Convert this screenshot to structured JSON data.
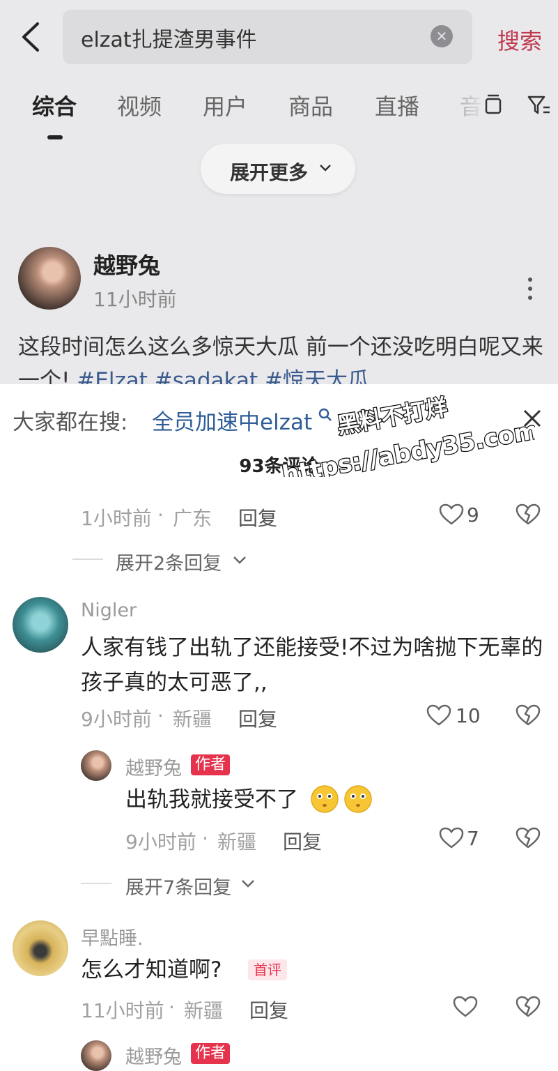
{
  "search": {
    "query": "elzat扎提渣男事件",
    "submit_label": "搜索"
  },
  "tabs": [
    {
      "label": "综合",
      "active": true
    },
    {
      "label": "视频"
    },
    {
      "label": "用户"
    },
    {
      "label": "商品"
    },
    {
      "label": "直播"
    },
    {
      "label": "音"
    }
  ],
  "expand_more_label": "展开更多",
  "post": {
    "author": "越野兔",
    "time": "11小时前",
    "text": "这段时间怎么这么多惊天大瓜 前一个还没吃明白呢又来一个!",
    "tags": [
      "#Elzat",
      "#sadakat",
      "#惊天大瓜"
    ]
  },
  "suggest": {
    "label": "大家都在搜:",
    "term": "全员加速中elzat"
  },
  "watermark": {
    "line1": "黑料不打烊",
    "line2": "https://abdy35.com"
  },
  "comment_count": "93条评论",
  "comments": {
    "c0": {
      "time": "1小时前",
      "region": "广东",
      "reply": "回复",
      "likes": "9",
      "expand": "展开2条回复"
    },
    "c1": {
      "name": "Nigler",
      "text": "人家有钱了出轨了还能接受!不过为啥抛下无辜的孩子真的太可恶了,,",
      "time": "9小时前",
      "region": "新疆",
      "reply": "回复",
      "likes": "10"
    },
    "c1r": {
      "name": "越野兔",
      "badge": "作者",
      "text": "出轨我就接受不了",
      "time": "9小时前",
      "region": "新疆",
      "reply": "回复",
      "likes": "7",
      "expand": "展开7条回复"
    },
    "c2": {
      "name": "早點睡.",
      "text": "怎么才知道啊?",
      "badge": "首评",
      "time": "11小时前",
      "region": "新疆",
      "reply": "回复"
    },
    "c2r": {
      "name": "越野兔",
      "badge": "作者"
    }
  },
  "colors": {
    "accent": "#e6334d",
    "search_red": "#c0394f",
    "link_blue": "#2f5d97"
  }
}
